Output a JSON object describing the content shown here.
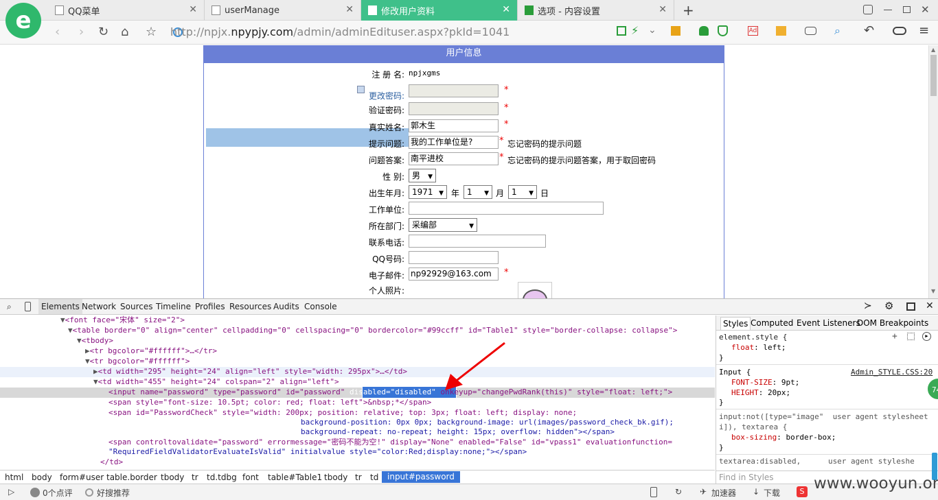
{
  "tabs": [
    {
      "label": "QQ菜单"
    },
    {
      "label": "userManage"
    },
    {
      "label": "修改用户资料"
    },
    {
      "label": "选项 - 内容设置"
    }
  ],
  "new_tab": "+",
  "address": {
    "prefix": "http://npjx.",
    "domain": "npypjy.com",
    "path": "/admin/adminEdituser.aspx?pkId=1041"
  },
  "form": {
    "header": "用户信息",
    "username_label": "注 册 名:",
    "username_value": "npjxgms",
    "change_pwd_label": "更改密码:",
    "verify_pwd_label": "验证密码:",
    "realname_label": "真实姓名:",
    "realname_value": "郭木生",
    "question_label": "提示问题:",
    "question_value": "我的工作单位是?",
    "question_note": "忘记密码的提示问题",
    "answer_label": "问题答案:",
    "answer_value": "南平进校",
    "answer_note": "忘记密码的提示问题答案，用于取回密码",
    "gender_label": "性 别:",
    "gender_value": "男",
    "birth_label": "出生年月:",
    "birth_year": "1971",
    "year_unit": "年",
    "birth_month": "1",
    "month_unit": "月",
    "birth_day": "1",
    "day_unit": "日",
    "work_label": "工作单位:",
    "dept_label": "所在部门:",
    "dept_value": "采编部",
    "phone_label": "联系电话:",
    "qq_label": "QQ号码:",
    "email_label": "电子邮件:",
    "email_value": "np92929@163.com",
    "photo_label": "个人照片:",
    "required": "*"
  },
  "devtools": {
    "tabs": [
      "Elements",
      "Network",
      "Sources",
      "Timeline",
      "Profiles",
      "Resources",
      "Audits",
      "Console"
    ],
    "breadcrumb": [
      "html",
      "body",
      "form#user",
      "table.border",
      "tbody",
      "tr",
      "td.tdbg",
      "font",
      "table#Table1",
      "tbody",
      "tr",
      "td",
      "input#password"
    ],
    "style_tabs": [
      "Styles",
      "Computed",
      "Event Listeners",
      "DOM Breakpoints"
    ],
    "find_placeholder": "Find in Styles",
    "code": {
      "l1": "<font face=\"宋体\" size=\"2\">",
      "l2": "<table border=\"0\" align=\"center\" cellpadding=\"0\" cellspacing=\"0\" bordercolor=\"#99ccff\" id=\"Table1\" style=\"border-collapse: collapse\">",
      "l3": "<tbody>",
      "l4": "<tr bgcolor=\"#ffffff\">…</tr>",
      "l5": "<tr bgcolor=\"#ffffff\">",
      "l6": "<td width=\"295\" height=\"24\" align=\"left\" style=\"width: 295px\">…</td>",
      "l7": "<td width=\"455\" height=\"24\" colspan=\"2\" align=\"left\">",
      "l8a": "<input name=\"password\" type=\"password\" id=\"password\" ",
      "l8b": "disabled=\"disabled\"",
      "l8c": " onkeyup=\"changePwdRank(this)\" style=\"float: left;\">",
      "l9": "<span style=\"font-size: 10.5pt; color: red; float: left\">&nbsp;*</span>",
      "l10": "<span id=\"PasswordCheck\" style=\"width: 200px; position: relative; top: 3px; float: left; display: none;",
      "l11": "background-position: 0px 0px; background-image: url(images/password_check_bk.gif);",
      "l12": "background-repeat: no-repeat; height: 15px; overflow: hidden\"></span>",
      "l13": "<span controltovalidate=\"password\" errormessage=\"密码不能为空!\" display=\"None\" enabled=\"False\" id=\"vpass1\" evaluationfunction=",
      "l14": "\"RequiredFieldValidatorEvaluateIsValid\" initialvalue style=\"color:Red;display:none;\"></span>",
      "l15": "</td>"
    },
    "styles": {
      "s1": "element.style {",
      "s2a": "float",
      "s2b": ": left;",
      "s3": "}",
      "s4": "Input {",
      "s4src": "Admin_STYLE.CSS:20",
      "s5a": "FONT-SIZE",
      "s5b": ": 9pt;",
      "s6a": "HEIGHT",
      "s6b": ": 20px;",
      "s7": "}",
      "s8": "input:not([type=\"image\"  user agent stylesheet",
      "s9": "i]), textarea {",
      "s10a": "box-sizing",
      "s10b": ": border-box;",
      "s11": "}",
      "s12": "textarea:disabled,      user agent styleshe"
    }
  },
  "status": {
    "comments": "0个点评",
    "recommend": "好搜推荐",
    "accelerator": "加速器",
    "download": "下载",
    "watermark": "www.wooyun.org",
    "badge": "74"
  }
}
